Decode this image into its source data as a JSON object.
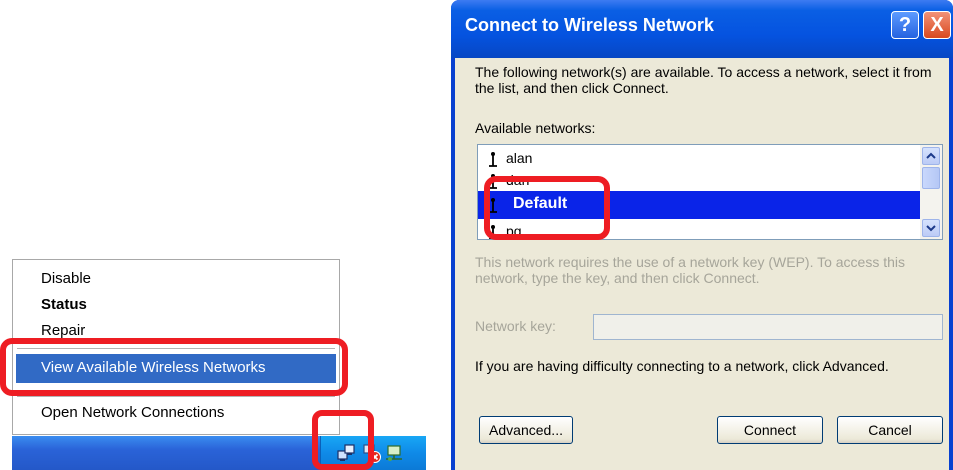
{
  "context_menu": {
    "items": [
      "Disable",
      "Status",
      "Repair",
      "View Available Wireless Networks",
      "Open Network Connections"
    ],
    "highlighted_item": "View Available Wireless Networks",
    "highlight_color": "#316ac5"
  },
  "tray": {
    "icons": [
      "wireless-network-icon",
      "network-disconnected-icon",
      "network-icon"
    ]
  },
  "dialog": {
    "title": "Connect to Wireless Network",
    "help_label": "?",
    "close_label": "X",
    "instructions": "The following network(s) are available. To access a network, select it from the list, and then click Connect.",
    "available_label": "Available networks:",
    "networks": [
      "alan",
      "dan",
      "Default",
      "pg"
    ],
    "selected_network": "Default",
    "wep_note": "This network requires the use of a network key (WEP). To access this network, type the key, and then click Connect.",
    "key_label": "Network key:",
    "key_value": "",
    "advice": "If you are having difficulty connecting to a network, click Advanced.",
    "buttons": {
      "advanced": "Advanced...",
      "connect": "Connect",
      "cancel": "Cancel"
    }
  },
  "colors": {
    "titlebar": "#0553e0",
    "selection": "#0a24e8",
    "annotation": "#ee1d23",
    "taskbar": "#2a63d8"
  }
}
